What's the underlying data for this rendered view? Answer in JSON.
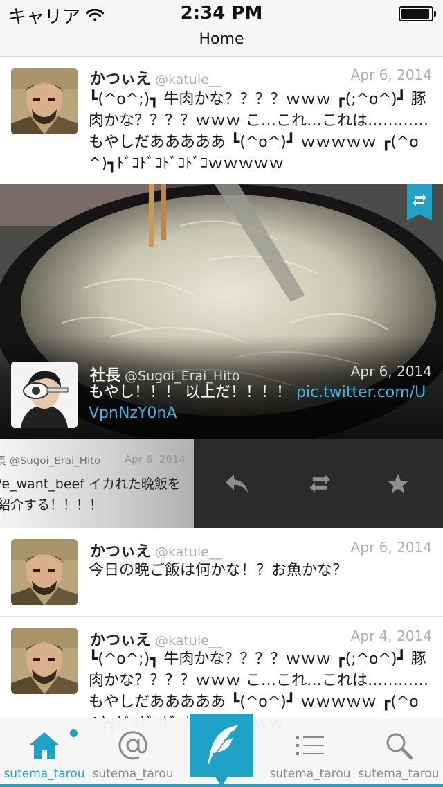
{
  "status_bar": {
    "carrier": "キャリア",
    "time": "2:34 PM"
  },
  "nav": {
    "title": "Home"
  },
  "tweets": [
    {
      "name": "かつぃえ",
      "handle": "@katuie__",
      "date": "Apr 6, 2014",
      "text": "┗(^o^;)┓ 牛肉かな？？？？ｗｗｗ ┏(;^o^)┛ 豚肉かな？？？？ｗｗｗ こ…これ…これは…………もやしだあああああ ┗(^o^)┛ ｗｗｗｗｗ ┏(^o^)┓ﾄﾞｺﾄﾞｺﾄﾞｺﾄﾞｺｗｗｗｗｗ"
    },
    {
      "name": "社長",
      "handle": "@Sugoi_Erai_Hito",
      "date": "Apr 6, 2014",
      "text": "もやし！！！ 以上だ！！！！ ",
      "link": "pic.twitter.com/UVpnNzY0nA"
    },
    {
      "name": "かつぃえ",
      "handle": "@katuie__",
      "date": "Apr 6, 2014",
      "text": "今日の晩ご飯は何かな！？お魚かな？"
    },
    {
      "name": "かつぃえ",
      "handle": "@katuie__",
      "date": "Apr 4, 2014",
      "text": "┗(^o^;)┓ 牛肉かな？？？？ｗｗｗ ┏(;^o^)┛ 豚肉かな？？？？ｗｗｗ こ…これ…これは…………もやしだあああああ ┗(^o^)┛ ｗｗｗｗｗ ┏(^o^)┓ﾄﾞｺﾄﾞｺﾄﾞｺﾄﾞｺｗｗｗｗｗ"
    }
  ],
  "swipe_preview": {
    "name_line": "長 @Sugoi_Erai_Hito",
    "date": "Apr 6, 2014",
    "text": "/e_want_beef イカれた晩飯を紹介する！！！！"
  },
  "tabs": [
    {
      "icon": "home-icon",
      "label": "sutema_tarou",
      "active": true
    },
    {
      "icon": "at-icon",
      "label": "sutema_tarou"
    },
    {
      "icon": "compose-feather-icon",
      "label": ""
    },
    {
      "icon": "list-icon",
      "label": "sutema_tarou"
    },
    {
      "icon": "search-icon",
      "label": "sutema_tarou"
    }
  ],
  "colors": {
    "accent": "#1fa2c8",
    "link": "#39b7e6",
    "swipe_bg": "#2a2c2c"
  }
}
